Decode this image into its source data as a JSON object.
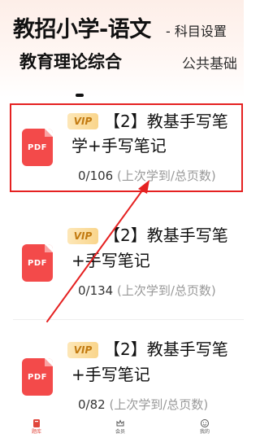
{
  "header": {
    "title": "教招小学-语文",
    "subject_switch": "- 科目设置"
  },
  "tabs": [
    {
      "label": "教育理论综合",
      "active": true
    },
    {
      "label": "公共基础",
      "active": false
    }
  ],
  "items": [
    {
      "badge": "VIP",
      "title_line1": "【2】教基手写笔",
      "title_line2": "学+手写笔记",
      "progress": "0/106",
      "progress_hint": "(上次学到/总页数)",
      "file_type": "PDF"
    },
    {
      "badge": "VIP",
      "title_line1": "【2】教基手写笔",
      "title_line2": "+手写笔记",
      "progress": "0/134",
      "progress_hint": "(上次学到/总页数)",
      "file_type": "PDF"
    },
    {
      "badge": "VIP",
      "title_line1": "【2】教基手写笔",
      "title_line2": "+手写笔记",
      "progress": "0/82",
      "progress_hint": "(上次学到/总页数)",
      "file_type": "PDF"
    }
  ],
  "bottom_nav": [
    {
      "label": "题库",
      "icon": "book-icon",
      "active": true
    },
    {
      "label": "会员",
      "icon": "crown-icon",
      "active": false
    },
    {
      "label": "我的",
      "icon": "smiley-icon",
      "active": false
    }
  ],
  "colors": {
    "accent": "#e0463b",
    "highlight": "#e52121",
    "pdf": "#f34a4a",
    "vip_text": "#c27a10"
  }
}
